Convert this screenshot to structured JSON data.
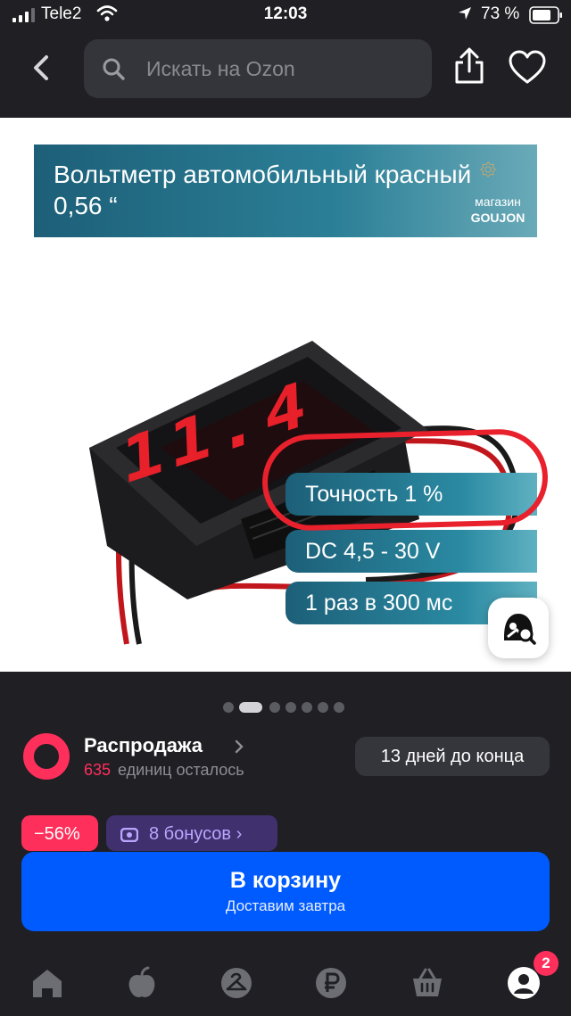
{
  "status_bar": {
    "carrier": "Tele2",
    "time": "12:03",
    "battery": "73 %"
  },
  "header": {
    "search_placeholder": "Искать на Ozon"
  },
  "product_image": {
    "banner_title": "Вольтметр автомобильный красный 0,56 “",
    "shop_logo_top": "магазин",
    "shop_logo_bottom": "GOUJON",
    "specs": [
      "Точность 1 %",
      "DC 4,5 - 30 V",
      "1 раз в 300 мс"
    ]
  },
  "carousel": {
    "total": 7,
    "active": 2
  },
  "sale": {
    "title": "Распродажа",
    "count": "635",
    "count_suffix": "единиц осталось",
    "days_left": "13 дней до конца"
  },
  "chips": {
    "discount": "−56%",
    "bonus": "8 бонусов ›"
  },
  "cart": {
    "label": "В корзину",
    "sub": "Доставим завтра"
  },
  "bottom_nav": {
    "badge": "2",
    "items": [
      "home-icon",
      "fresh-icon",
      "catalog-icon",
      "finance-icon",
      "cart-icon",
      "profile-icon"
    ]
  },
  "colors": {
    "accent": "#005bff",
    "sale": "#ff2f5b",
    "bonus": "#40306e",
    "background": "#1f1f24"
  }
}
